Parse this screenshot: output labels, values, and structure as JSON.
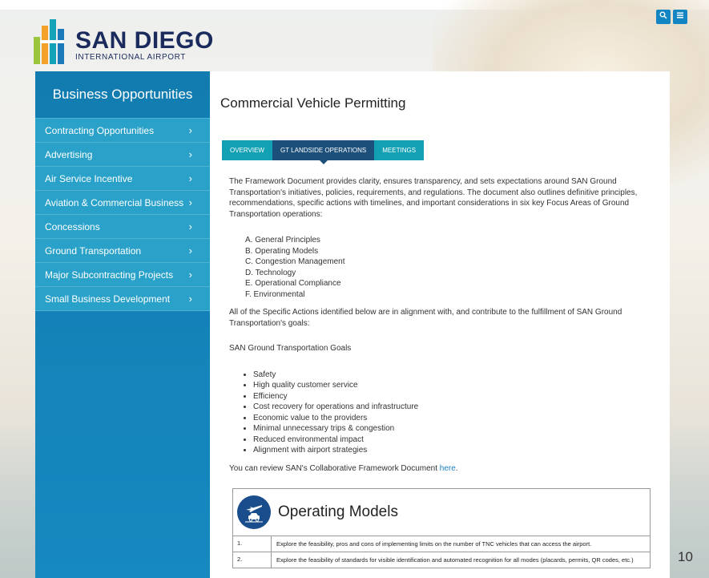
{
  "header": {
    "logo_name": "SAN DIEGO",
    "logo_sub": "INTERNATIONAL AIRPORT",
    "search_icon": "search-icon",
    "menu_icon": "menu-icon"
  },
  "sidebar": {
    "title": "Business Opportunities",
    "items": [
      {
        "label": "Contracting Opportunities"
      },
      {
        "label": "Advertising"
      },
      {
        "label": "Air Service Incentive"
      },
      {
        "label": "Aviation & Commercial Business"
      },
      {
        "label": "Concessions"
      },
      {
        "label": "Ground Transportation"
      },
      {
        "label": "Major Subcontracting Projects"
      },
      {
        "label": "Small Business Development"
      }
    ]
  },
  "main": {
    "title": "Commercial Vehicle Permitting",
    "tabs": [
      {
        "label": "OVERVIEW"
      },
      {
        "label": "GT LANDSIDE OPERATIONS"
      },
      {
        "label": "MEETINGS"
      }
    ],
    "intro": "The Framework Document provides clarity, ensures transparency, and sets expectations around SAN Ground Transportation's initiatives, policies, requirements, and regulations. The document also outlines definitive principles, recommendations, specific actions with timelines, and important considerations in six key Focus Areas of Ground Transportation operations:",
    "focus_areas": [
      "A. General Principles",
      "B. Operating Models",
      "C. Congestion Management",
      "D. Technology",
      "E. Operational Compliance",
      "F. Environmental"
    ],
    "alignment": "All of the Specific Actions identified below are in alignment with, and contribute to the fulfillment of SAN Ground Transportation's goals:",
    "goals_heading": "SAN Ground Transportation Goals",
    "goals": [
      "Safety",
      "High quality customer service",
      "Efficiency",
      "Cost recovery for operations and infrastructure",
      "Economic value to the providers",
      "Minimal unnecessary trips & congestion",
      "Reduced environmental impact",
      "Alignment with airport strategies"
    ],
    "review_text": "You can review SAN's Collaborative Framework Document ",
    "review_link": "here",
    "review_end": "."
  },
  "table": {
    "title": "Operating Models",
    "rows": [
      {
        "num": "1.",
        "text": "Explore the feasibility, pros and cons of implementing limits on the number of TNC vehicles that can access the airport."
      },
      {
        "num": "2.",
        "text": "Explore the feasibility of standards for visible identification and automated recognition for all modes (placards, permits, QR codes, etc.)"
      }
    ]
  },
  "page_number": "10",
  "colors": {
    "sidebar": "#127cb0",
    "sidebar_item": "#2aa1c9",
    "tab": "#12a0b5",
    "tab_active": "#1c4f7a",
    "link": "#1a7fc1"
  }
}
